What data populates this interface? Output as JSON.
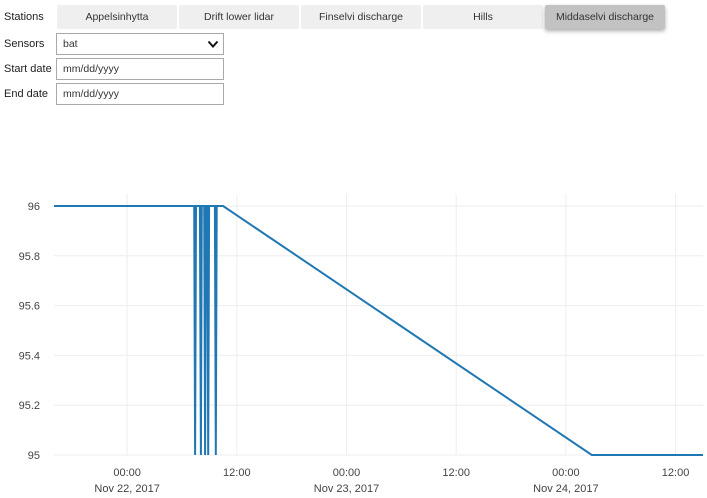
{
  "labels": {
    "stations": "Stations",
    "sensors": "Sensors",
    "start_date": "Start date",
    "end_date": "End date"
  },
  "stations": [
    {
      "label": "Appelsinhytta",
      "active": false
    },
    {
      "label": "Drift lower lidar",
      "active": false
    },
    {
      "label": "Finselvi discharge",
      "active": false
    },
    {
      "label": "Hills",
      "active": false
    },
    {
      "label": "Middaselvi discharge",
      "active": true
    }
  ],
  "sensor_select": {
    "value": "bat",
    "icon": "chevron-down-icon"
  },
  "start_date": {
    "placeholder": "mm/dd/yyyy"
  },
  "end_date": {
    "placeholder": "mm/dd/yyyy"
  },
  "colors": {
    "line": "#1f77b4",
    "grid": "#eeeeee",
    "active_tab": "#c2c2c2",
    "tab": "#efefef"
  },
  "chart_data": {
    "type": "line",
    "title": "",
    "xlabel": "",
    "ylabel": "",
    "ylim": [
      95,
      96
    ],
    "xlim": [
      "2017-11-21T16:00",
      "2017-11-24T15:00"
    ],
    "y_ticks": [
      "95",
      "95.2",
      "95.4",
      "95.6",
      "95.8",
      "96"
    ],
    "x_ticks": [
      {
        "time": "2017-11-22T00:00",
        "line1": "00:00",
        "line2": "Nov 22, 2017"
      },
      {
        "time": "2017-11-22T12:00",
        "line1": "12:00",
        "line2": ""
      },
      {
        "time": "2017-11-23T00:00",
        "line1": "00:00",
        "line2": "Nov 23, 2017"
      },
      {
        "time": "2017-11-23T12:00",
        "line1": "12:00",
        "line2": ""
      },
      {
        "time": "2017-11-24T00:00",
        "line1": "00:00",
        "line2": "Nov 24, 2017"
      },
      {
        "time": "2017-11-24T12:00",
        "line1": "12:00",
        "line2": ""
      }
    ],
    "grid": true,
    "series": [
      {
        "points": [
          {
            "x": "2017-11-21T16:00",
            "y": 96
          },
          {
            "x": "2017-11-22T07:20",
            "y": 96
          },
          {
            "x": "2017-11-22T07:26",
            "y": 95
          },
          {
            "x": "2017-11-22T07:32",
            "y": 96
          },
          {
            "x": "2017-11-22T07:58",
            "y": 96
          },
          {
            "x": "2017-11-22T08:04",
            "y": 95
          },
          {
            "x": "2017-11-22T08:10",
            "y": 96
          },
          {
            "x": "2017-11-22T08:26",
            "y": 96
          },
          {
            "x": "2017-11-22T08:32",
            "y": 95
          },
          {
            "x": "2017-11-22T08:38",
            "y": 96
          },
          {
            "x": "2017-11-22T08:46",
            "y": 96
          },
          {
            "x": "2017-11-22T08:52",
            "y": 95
          },
          {
            "x": "2017-11-22T08:58",
            "y": 96
          },
          {
            "x": "2017-11-22T09:36",
            "y": 96
          },
          {
            "x": "2017-11-22T09:42",
            "y": 95
          },
          {
            "x": "2017-11-22T09:48",
            "y": 96
          },
          {
            "x": "2017-11-22T10:30",
            "y": 96
          },
          {
            "x": "2017-11-24T02:50",
            "y": 95
          },
          {
            "x": "2017-11-24T15:00",
            "y": 95
          }
        ]
      }
    ]
  }
}
